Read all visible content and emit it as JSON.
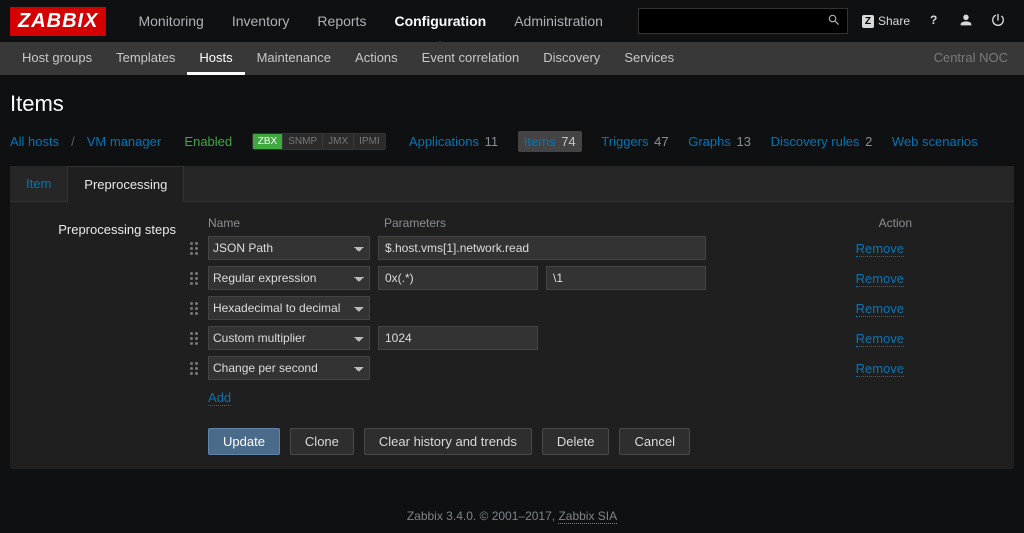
{
  "topnav": {
    "items": [
      "Monitoring",
      "Inventory",
      "Reports",
      "Configuration",
      "Administration"
    ],
    "active": 3,
    "share": "Share",
    "search_placeholder": ""
  },
  "subnav": {
    "items": [
      "Host groups",
      "Templates",
      "Hosts",
      "Maintenance",
      "Actions",
      "Event correlation",
      "Discovery",
      "Services"
    ],
    "active": 2,
    "right": "Central NOC"
  },
  "page": {
    "title": "Items"
  },
  "hostrow": {
    "all_hosts": "All hosts",
    "host": "VM manager",
    "enabled": "Enabled",
    "ifaces": [
      "ZBX",
      "SNMP",
      "JMX",
      "IPMI"
    ],
    "iface_on": 0,
    "links": [
      {
        "label": "Applications",
        "count": "11"
      },
      {
        "label": "Items",
        "count": "74",
        "active": true
      },
      {
        "label": "Triggers",
        "count": "47"
      },
      {
        "label": "Graphs",
        "count": "13"
      },
      {
        "label": "Discovery rules",
        "count": "2"
      },
      {
        "label": "Web scenarios",
        "count": ""
      }
    ]
  },
  "tabs": {
    "item": "Item",
    "preprocessing": "Preprocessing"
  },
  "form": {
    "label": "Preprocessing steps",
    "headers": {
      "name": "Name",
      "parameters": "Parameters",
      "action": "Action"
    },
    "steps": [
      {
        "name": "JSON Path",
        "p1": "$.host.vms[1].network.read",
        "p2": null,
        "p1w": "328"
      },
      {
        "name": "Regular expression",
        "p1": "0x(.*)",
        "p2": "\\1",
        "p1w": "160"
      },
      {
        "name": "Hexadecimal to decimal",
        "p1": null,
        "p2": null
      },
      {
        "name": "Custom multiplier",
        "p1": "1024",
        "p2": null,
        "p1w": "160"
      },
      {
        "name": "Change per second",
        "p1": null,
        "p2": null
      }
    ],
    "remove": "Remove",
    "add": "Add"
  },
  "buttons": {
    "update": "Update",
    "clone": "Clone",
    "clear": "Clear history and trends",
    "delete": "Delete",
    "cancel": "Cancel"
  },
  "footer": {
    "text": "Zabbix 3.4.0. © 2001–2017, ",
    "link": "Zabbix SIA"
  }
}
